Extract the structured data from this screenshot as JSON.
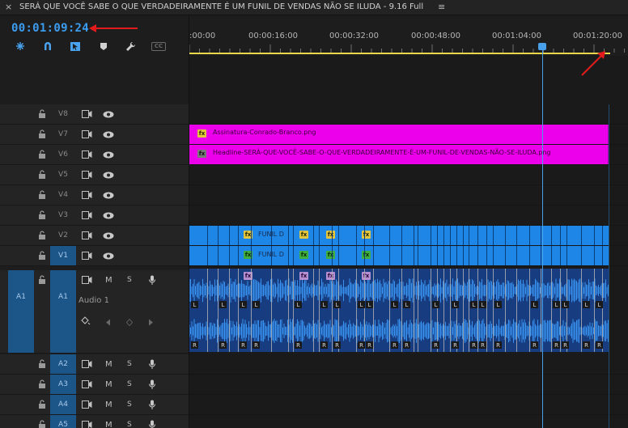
{
  "window": {
    "close_glyph": "×",
    "title": "SERÁ QUE VOCÊ SABE O QUE VERDADEIRAMENTE É UM FUNIL DE VENDAS NÃO SE ILUDA - 9.16 Full",
    "menu_glyph": "≡"
  },
  "timeline": {
    "timecode": "00:01:09:24",
    "ruler_labels": [
      ":00:00",
      "00:00:16:00",
      "00:00:32:00",
      "00:00:48:00",
      "00:01:04:00",
      "00:01:20:00"
    ]
  },
  "tools": [
    "snap-icon",
    "magnet-icon",
    "linked-selection-icon",
    "marker-icon",
    "wrench-icon",
    "captions-icon"
  ],
  "tools_captions_label": "CC",
  "video_tracks": [
    {
      "name": "V8",
      "target": false
    },
    {
      "name": "V7",
      "target": false
    },
    {
      "name": "V6",
      "target": false
    },
    {
      "name": "V5",
      "target": false
    },
    {
      "name": "V4",
      "target": false
    },
    {
      "name": "V3",
      "target": false
    },
    {
      "name": "V2",
      "target": false
    },
    {
      "name": "V1",
      "target": true
    }
  ],
  "audio_tracks": {
    "a1": {
      "source": "A1",
      "name": "A1",
      "label": "Audio 1",
      "m": "M",
      "s": "S"
    },
    "others": [
      {
        "name": "A2",
        "m": "M",
        "s": "S"
      },
      {
        "name": "A3",
        "m": "M",
        "s": "S"
      },
      {
        "name": "A4",
        "m": "M",
        "s": "S"
      },
      {
        "name": "A5",
        "m": "M",
        "s": "S"
      }
    ]
  },
  "clips": {
    "v7": {
      "fx": "fx",
      "label": "Assinatura-Conrado-Branco.png"
    },
    "v6": {
      "fx": "fx",
      "label": "Headline-SERÁ-QUE-VOCÊ-SABE-O-QUE-VERDADEIRAMENTE-É-UM-FUNIL-DE-VENDAS-NÃO-SE-ILUDA.png"
    },
    "v2_label": "FUNIL D",
    "v1_label": "FUNIL D",
    "fx": "fx",
    "left_channel": "L",
    "right_channel": "R"
  },
  "colors": {
    "timecode": "#3c9cf0",
    "graphic_clip": "#ec00ec",
    "video_clip": "#1e86e6",
    "audio_clip": "#173d80",
    "target_track": "#1c5689",
    "playhead": "#49a0ea",
    "annotation_arrow": "#e11b1b",
    "work_area_bar": "#e8d84a"
  }
}
